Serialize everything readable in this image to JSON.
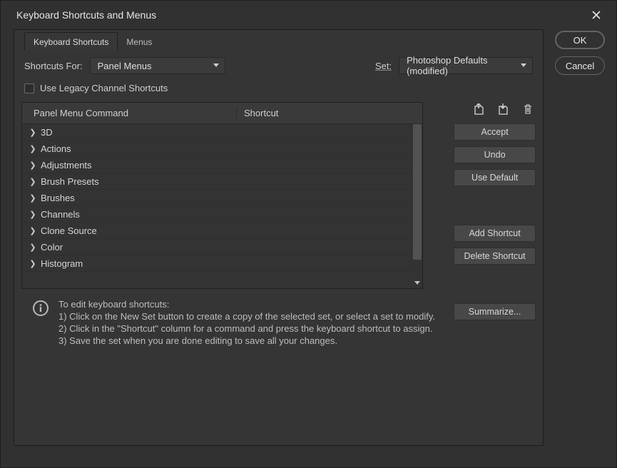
{
  "title": "Keyboard Shortcuts and Menus",
  "tabs": [
    {
      "label": "Keyboard Shortcuts",
      "active": true
    },
    {
      "label": "Menus",
      "active": false
    }
  ],
  "shortcuts_for_label": "Shortcuts For:",
  "shortcuts_for_value": "Panel Menus",
  "set_label": "Set:",
  "set_value": "Photoshop Defaults (modified)",
  "legacy_checkbox_label": "Use Legacy Channel Shortcuts",
  "table": {
    "col_command": "Panel Menu Command",
    "col_shortcut": "Shortcut",
    "rows": [
      "3D",
      "Actions",
      "Adjustments",
      "Brush Presets",
      "Brushes",
      "Channels",
      "Clone Source",
      "Color",
      "Histogram"
    ]
  },
  "actions": {
    "accept": "Accept",
    "undo": "Undo",
    "use_default": "Use Default",
    "add_shortcut": "Add Shortcut",
    "delete_shortcut": "Delete Shortcut",
    "summarize": "Summarize..."
  },
  "help": {
    "title": "To edit keyboard shortcuts:",
    "line1": "1) Click on the New Set button to create a copy of the selected set, or select a set to modify.",
    "line2": "2) Click in the \"Shortcut\" column for a command and press the keyboard shortcut to assign.",
    "line3": "3) Save the set when you are done editing to save all your changes."
  },
  "buttons": {
    "ok": "OK",
    "cancel": "Cancel"
  }
}
